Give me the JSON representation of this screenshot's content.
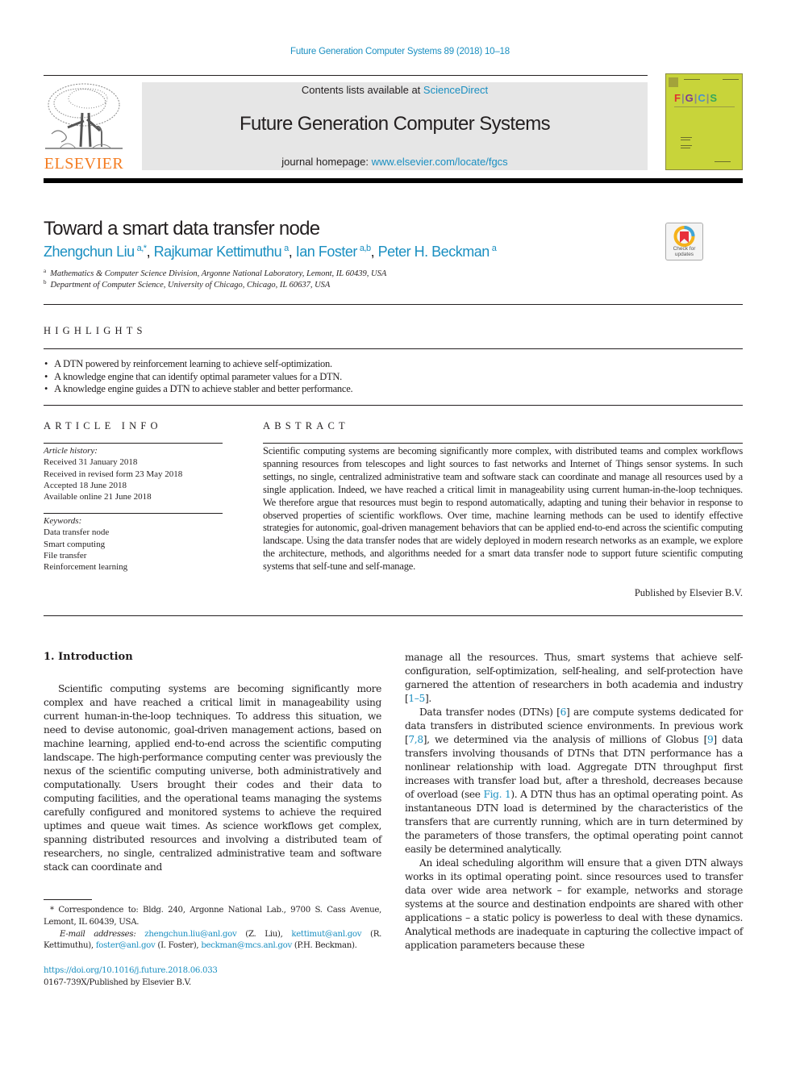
{
  "journal_citation": "Future Generation Computer Systems 89 (2018) 10–18",
  "banner": {
    "contents_prefix": "Contents lists available at ",
    "contents_link": "ScienceDirect",
    "journal_title": "Future Generation Computer Systems",
    "homepage_prefix": "journal homepage: ",
    "homepage_link": "www.elsevier.com/locate/fgcs"
  },
  "publisher_logo_text": "ELSEVIER",
  "cover": {
    "letters": [
      "F",
      "G",
      "C",
      "S"
    ],
    "letter_colors": [
      "#e0312f",
      "#7b3a96",
      "#4a8fd0",
      "#35a85a"
    ]
  },
  "check_updates": {
    "line1": "Check for",
    "line2": "updates"
  },
  "article": {
    "title": "Toward a smart data transfer node",
    "authors": [
      {
        "name": "Zhengchun Liu",
        "aff": "a,*"
      },
      {
        "name": "Rajkumar Kettimuthu",
        "aff": "a"
      },
      {
        "name": "Ian Foster",
        "aff": "a,b"
      },
      {
        "name": "Peter H. Beckman",
        "aff": "a"
      }
    ],
    "affiliations": [
      {
        "key": "a",
        "text": "Mathematics & Computer Science Division, Argonne National Laboratory, Lemont, IL 60439, USA"
      },
      {
        "key": "b",
        "text": "Department of Computer Science, University of Chicago, Chicago, IL 60637, USA"
      }
    ]
  },
  "highlights": {
    "label": "HIGHLIGHTS",
    "items": [
      "A DTN powered by reinforcement learning to achieve self-optimization.",
      "A knowledge engine that can identify optimal parameter values for a DTN.",
      "A knowledge engine guides a DTN to achieve stabler and better performance."
    ]
  },
  "article_info": {
    "label": "ARTICLE INFO",
    "history_label": "Article history:",
    "history": [
      "Received 31 January 2018",
      "Received in revised form 23 May 2018",
      "Accepted 18 June 2018",
      "Available online 21 June 2018"
    ],
    "keywords_label": "Keywords:",
    "keywords": [
      "Data transfer node",
      "Smart computing",
      "File transfer",
      "Reinforcement learning"
    ]
  },
  "abstract": {
    "label": "ABSTRACT",
    "text": "Scientific computing systems are becoming significantly more complex, with distributed teams and complex workflows spanning resources from telescopes and light sources to fast networks and Internet of Things sensor systems. In such settings, no single, centralized administrative team and software stack can coordinate and manage all resources used by a single application. Indeed, we have reached a critical limit in manageability using current human-in-the-loop techniques. We therefore argue that resources must begin to respond automatically, adapting and tuning their behavior in response to observed properties of scientific workflows. Over time, machine learning methods can be used to identify effective strategies for autonomic, goal-driven management behaviors that can be applied end-to-end across the scientific computing landscape. Using the data transfer nodes that are widely deployed in modern research networks as an example, we explore the architecture, methods, and algorithms needed for a smart data transfer node to support future scientific computing systems that self-tune and self-manage.",
    "publisher": "Published by Elsevier B.V."
  },
  "introduction": {
    "heading": "1.  Introduction",
    "left_para": "Scientific computing systems are becoming significantly more complex and have reached a critical limit in manageability using current human-in-the-loop techniques. To address this situation, we need to devise autonomic, goal-driven management actions, based on machine learning, applied end-to-end across the scientific computing landscape. The high-performance computing center was previously the nexus of the scientific computing universe, both administratively and computationally. Users brought their codes and their data to computing facilities, and the operational teams managing the systems carefully configured and monitored systems to achieve the required uptimes and queue wait times. As science workflows get complex, spanning distributed resources and involving a distributed team of researchers, no single, centralized administrative team and software stack can coordinate and",
    "right_p1_a": "manage all the resources. Thus, smart systems that achieve self-configuration, self-optimization, self-healing, and self-protection have garnered the attention of researchers in both academia and industry [",
    "right_p1_ref": "1–5",
    "right_p1_b": "].",
    "right_p2_a": "Data transfer nodes (DTNs) [",
    "right_p2_ref1": "6",
    "right_p2_b": "] are compute systems dedicated for data transfers in distributed science environments. In previous work [",
    "right_p2_ref2": "7,8",
    "right_p2_c": "], we determined via the analysis of millions of Globus [",
    "right_p2_ref3": "9",
    "right_p2_d": "] data transfers involving thousands of DTNs that DTN performance has a nonlinear relationship with load. Aggregate DTN throughput first increases with transfer load but, after a threshold, decreases because of overload (see ",
    "right_p2_fig": "Fig. 1",
    "right_p2_e": "). A DTN thus has an optimal operating point. As instantaneous DTN load is determined by the characteristics of the transfers that are currently running, which are in turn determined by the parameters of those transfers, the optimal operating point cannot easily be determined analytically.",
    "right_p3": "An ideal scheduling algorithm will ensure that a given DTN always works in its optimal operating point. since resources used to transfer data over wide area network – for example, networks and storage systems at the source and destination endpoints are shared with other applications – a static policy is powerless to deal with these dynamics. Analytical methods are inadequate in capturing the collective impact of application parameters because these"
  },
  "footnote": {
    "star_text": "* Correspondence to: Bldg. 240, Argonne National Lab., 9700 S. Cass Avenue, Lemont, IL 60439, USA.",
    "email_label": "E-mail addresses: ",
    "emails": [
      {
        "addr": "zhengchun.liu@anl.gov",
        "who": " (Z. Liu), "
      },
      {
        "addr": "kettimut@anl.gov",
        "who": " (R. Kettimuthu), "
      },
      {
        "addr": "foster@anl.gov",
        "who": " (I. Foster), "
      },
      {
        "addr": "beckman@mcs.anl.gov",
        "who": " (P.H. Beckman)."
      }
    ],
    "doi": "https://doi.org/10.1016/j.future.2018.06.033",
    "issn": "0167-739X/Published by Elsevier B.V."
  }
}
